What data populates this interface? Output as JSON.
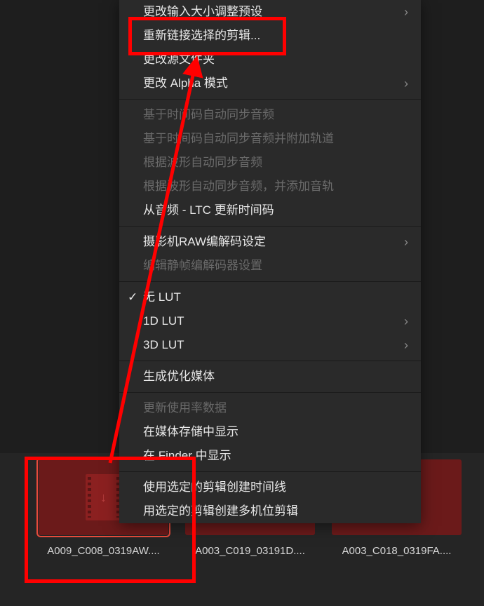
{
  "menu": {
    "items": [
      {
        "label": "更改输入大小调整预设",
        "enabled": true,
        "submenu": true,
        "checked": false
      },
      {
        "label": "重新链接选择的剪辑...",
        "enabled": true,
        "submenu": false,
        "checked": false
      },
      {
        "label": "更改源文件夹",
        "enabled": true,
        "submenu": false,
        "checked": false
      },
      {
        "label": "更改 Alpha 模式",
        "enabled": true,
        "submenu": true,
        "checked": false
      },
      {
        "divider": true
      },
      {
        "label": "基于时间码自动同步音频",
        "enabled": false,
        "submenu": false,
        "checked": false
      },
      {
        "label": "基于时间码自动同步音频并附加轨道",
        "enabled": false,
        "submenu": false,
        "checked": false
      },
      {
        "label": "根据波形自动同步音频",
        "enabled": false,
        "submenu": false,
        "checked": false
      },
      {
        "label": "根据波形自动同步音频，并添加音轨",
        "enabled": false,
        "submenu": false,
        "checked": false
      },
      {
        "label": "从音频 - LTC 更新时间码",
        "enabled": true,
        "submenu": false,
        "checked": false
      },
      {
        "divider": true
      },
      {
        "label": "摄影机RAW编解码设定",
        "enabled": true,
        "submenu": true,
        "checked": false
      },
      {
        "label": "编辑静帧编解码器设置",
        "enabled": false,
        "submenu": false,
        "checked": false
      },
      {
        "divider": true
      },
      {
        "label": "无 LUT",
        "enabled": true,
        "submenu": false,
        "checked": true
      },
      {
        "label": "1D LUT",
        "enabled": true,
        "submenu": true,
        "checked": false
      },
      {
        "label": "3D LUT",
        "enabled": true,
        "submenu": true,
        "checked": false
      },
      {
        "divider": true
      },
      {
        "label": "生成优化媒体",
        "enabled": true,
        "submenu": false,
        "checked": false
      },
      {
        "divider": true
      },
      {
        "label": "更新使用率数据",
        "enabled": false,
        "submenu": false,
        "checked": false
      },
      {
        "label": "在媒体存储中显示",
        "enabled": true,
        "submenu": false,
        "checked": false
      },
      {
        "label": "在 Finder 中显示",
        "enabled": true,
        "submenu": false,
        "checked": false
      },
      {
        "divider": true
      },
      {
        "label": "使用选定的剪辑创建时间线",
        "enabled": true,
        "submenu": false,
        "checked": false
      },
      {
        "label": "用选定的剪辑创建多机位剪辑",
        "enabled": true,
        "submenu": false,
        "checked": false
      }
    ]
  },
  "clips": [
    {
      "label": "A009_C008_0319AW....",
      "selected": true
    },
    {
      "label": "A003_C019_03191D....",
      "selected": false
    },
    {
      "label": "A003_C018_0319FA....",
      "selected": false
    }
  ]
}
